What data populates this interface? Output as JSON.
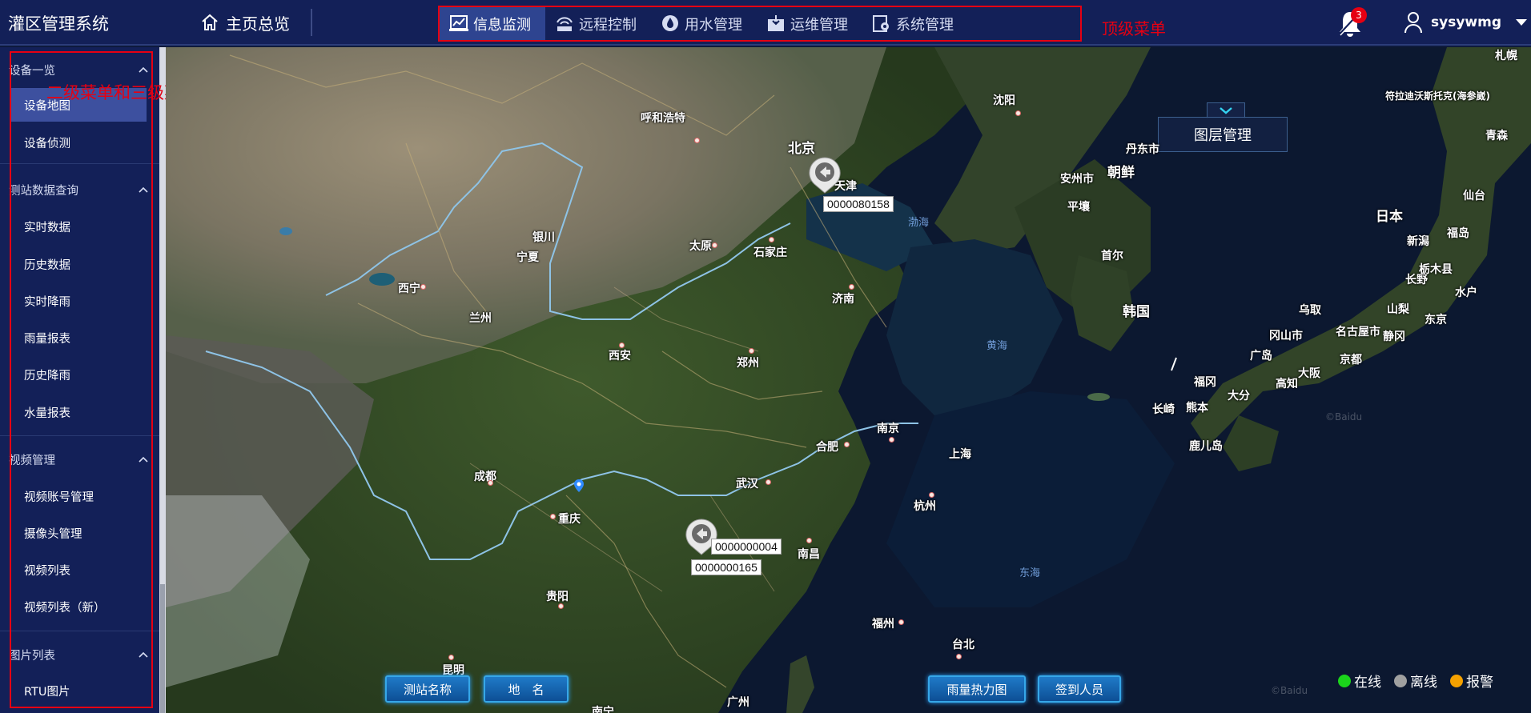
{
  "app": {
    "title": "灌区管理系统"
  },
  "home": {
    "label": "主页总览",
    "icon": "home-icon"
  },
  "top_menu": {
    "items": [
      {
        "label": "信息监测",
        "icon": "chart-monitor-icon",
        "active": true
      },
      {
        "label": "远程控制",
        "icon": "remote-control-icon",
        "active": false
      },
      {
        "label": "用水管理",
        "icon": "water-drop-icon",
        "active": false
      },
      {
        "label": "运维管理",
        "icon": "maintenance-icon",
        "active": false
      },
      {
        "label": "系统管理",
        "icon": "system-settings-icon",
        "active": false
      }
    ],
    "annotation": "顶级菜单"
  },
  "notifications": {
    "count": "3",
    "icon": "bell-icon"
  },
  "user": {
    "name": "sysywmg",
    "icon": "user-icon"
  },
  "sidebar": {
    "annotation": "二级菜单和三级菜单",
    "groups": [
      {
        "title": "设备一览",
        "items": [
          "设备地图",
          "设备侦测"
        ],
        "active_item": "设备地图"
      },
      {
        "title": "测站数据查询",
        "items": [
          "实时数据",
          "历史数据",
          "实时降雨",
          "雨量报表",
          "历史降雨",
          "水量报表"
        ]
      },
      {
        "title": "视频管理",
        "items": [
          "视频账号管理",
          "摄像头管理",
          "视频列表",
          "视频列表（新）"
        ]
      },
      {
        "title": "图片列表",
        "items": [
          "RTU图片"
        ]
      }
    ]
  },
  "map": {
    "layer_button": "图层管理",
    "cities": [
      "沈阳",
      "呼和浩特",
      "北京",
      "天津",
      "银川",
      "太原",
      "石家庄",
      "西宁",
      "兰州",
      "济南",
      "西安",
      "郑州",
      "成都",
      "重庆",
      "武汉",
      "合肥",
      "南京",
      "上海",
      "杭州",
      "南昌",
      "贵阳",
      "福州",
      "昆明",
      "台北",
      "南宁",
      "广州",
      "首尔",
      "丹东市",
      "安州市",
      "平壤",
      "朝鲜",
      "韩国",
      "日本",
      "札幌",
      "青森",
      "仙台",
      "福岛",
      "新潟",
      "长野",
      "水户",
      "东京",
      "山梨",
      "静冈",
      "名古屋市",
      "京都",
      "大阪",
      "乌取",
      "冈山市",
      "广岛",
      "高知",
      "福冈",
      "长崎",
      "熊本",
      "大分",
      "鹿儿岛",
      "栃木县",
      "符拉迪沃斯托克(海参崴)",
      "宁夏"
    ],
    "seas": [
      "渤海",
      "黄海",
      "东海"
    ],
    "markers": [
      {
        "labels": [
          "0000080158"
        ]
      },
      {
        "labels": [
          "0000000004",
          "0000000165"
        ]
      }
    ],
    "bottom_buttons": [
      "测站名称",
      "地　名",
      "雨量热力图",
      "签到人员"
    ],
    "legend": [
      {
        "label": "在线",
        "color": "#1bd41b"
      },
      {
        "label": "离线",
        "color": "#a0a0a0"
      },
      {
        "label": "报警",
        "color": "#f5a100"
      }
    ],
    "watermark": "©Baidu"
  }
}
